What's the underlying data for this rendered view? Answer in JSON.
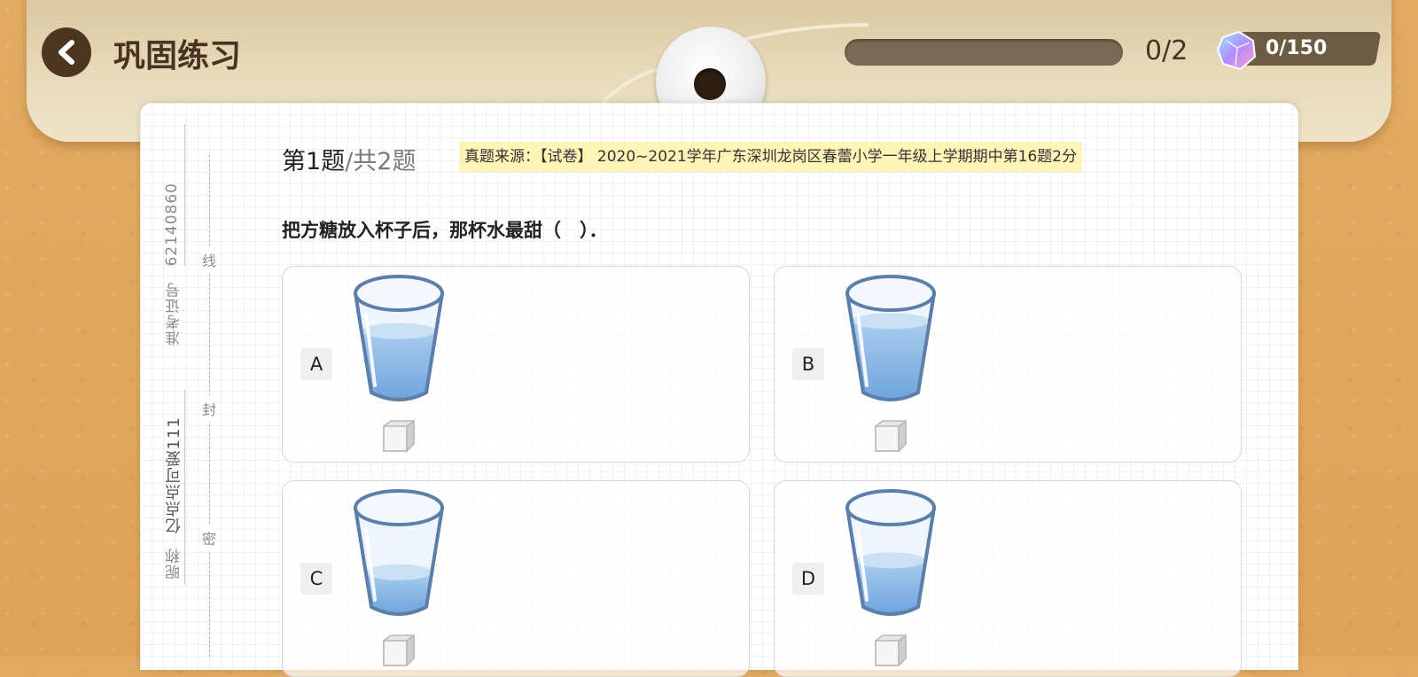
{
  "header": {
    "title": "巩固练习",
    "progress_text": "0/2",
    "progress_fraction": 0,
    "score_text": "0/150"
  },
  "sidebar": {
    "exam_id": "62140860",
    "exam_id_label": "准考证号",
    "nickname": "亿点点可爱111",
    "nickname_label": "昵称",
    "seal_marks": [
      "线",
      "封",
      "密"
    ]
  },
  "question": {
    "number": "第1题",
    "total": "/共2题",
    "source": "真题来源：【试卷】 2020~2021学年广东深圳龙岗区春蕾小学一年级上学期期中第16题2分",
    "text": "把方糖放入杯子后，那杯水最甜（　）．"
  },
  "options": [
    {
      "label": "A",
      "water_level": 0.62
    },
    {
      "label": "B",
      "water_level": 0.72
    },
    {
      "label": "C",
      "water_level": 0.35
    },
    {
      "label": "D",
      "water_level": 0.47
    }
  ],
  "colors": {
    "background": "#dfa55c",
    "board": "#e7d8b8",
    "title": "#4a3220",
    "highlight": "#fff4b8"
  }
}
